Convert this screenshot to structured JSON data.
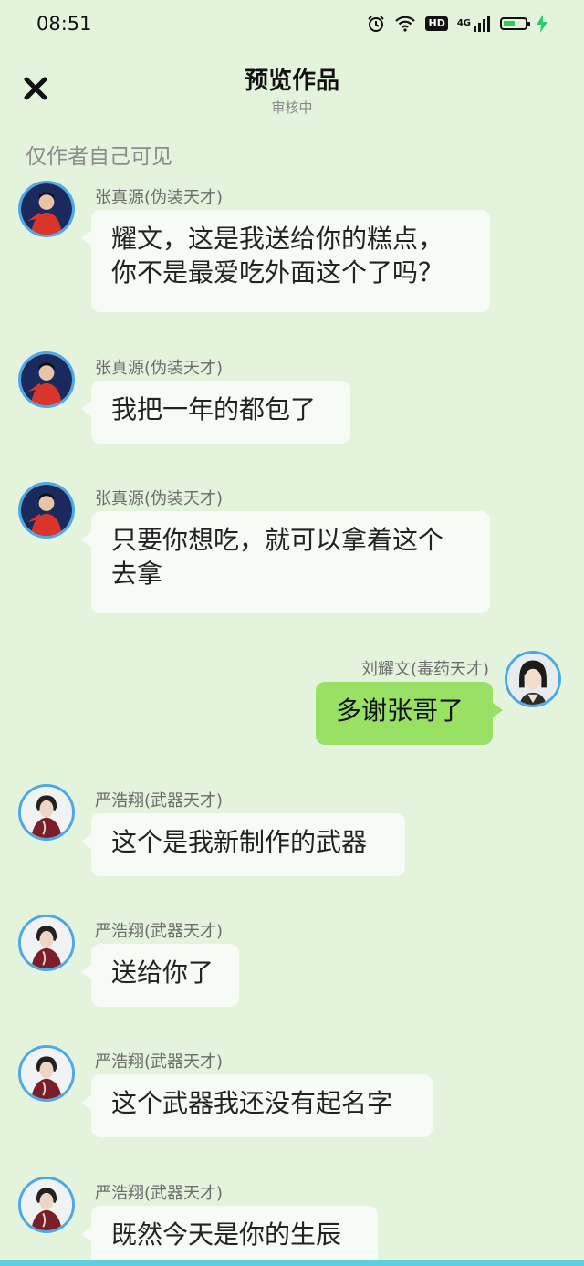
{
  "status_bar": {
    "time": "08:51",
    "hd_label": "HD",
    "network_label": "4G",
    "battery_level": 0.55,
    "icons": [
      "alarm-icon",
      "wifi-icon",
      "hd-icon",
      "signal-icon",
      "battery-icon",
      "charging-icon"
    ]
  },
  "header": {
    "title": "预览作品",
    "subtitle": "审核中",
    "close_icon": "close-icon"
  },
  "visibility_note": "仅作者自己可见",
  "messages": [
    {
      "side": "left",
      "name": "张真源(伪装天才)",
      "text": "耀文，这是我送给你的糕点，\n你不是最爱吃外面这个了吗？"
    },
    {
      "side": "left",
      "name": "张真源(伪装天才)",
      "text": "我把一年的都包了"
    },
    {
      "side": "left",
      "name": "张真源(伪装天才)",
      "text": "只要你想吃，就可以拿着这个\n去拿"
    },
    {
      "side": "right",
      "name": "刘耀文(毒药天才)",
      "text": "多谢张哥了"
    },
    {
      "side": "left",
      "name": "严浩翔(武器天才)",
      "text": "这个是我新制作的武器"
    },
    {
      "side": "left",
      "name": "严浩翔(武器天才)",
      "text": "送给你了"
    },
    {
      "side": "left",
      "name": "严浩翔(武器天才)",
      "text": "这个武器我还没有起名字"
    },
    {
      "side": "left",
      "name": "严浩翔(武器天才)",
      "text": "既然今天是你的生辰"
    }
  ],
  "colors": {
    "background": "#e4f4dc",
    "left_bubble": "#f7fbf5",
    "right_bubble": "#98e165",
    "avatar_ring": "#4da8e8",
    "battery_fill": "#38c95a",
    "charging": "#2ecc71"
  }
}
